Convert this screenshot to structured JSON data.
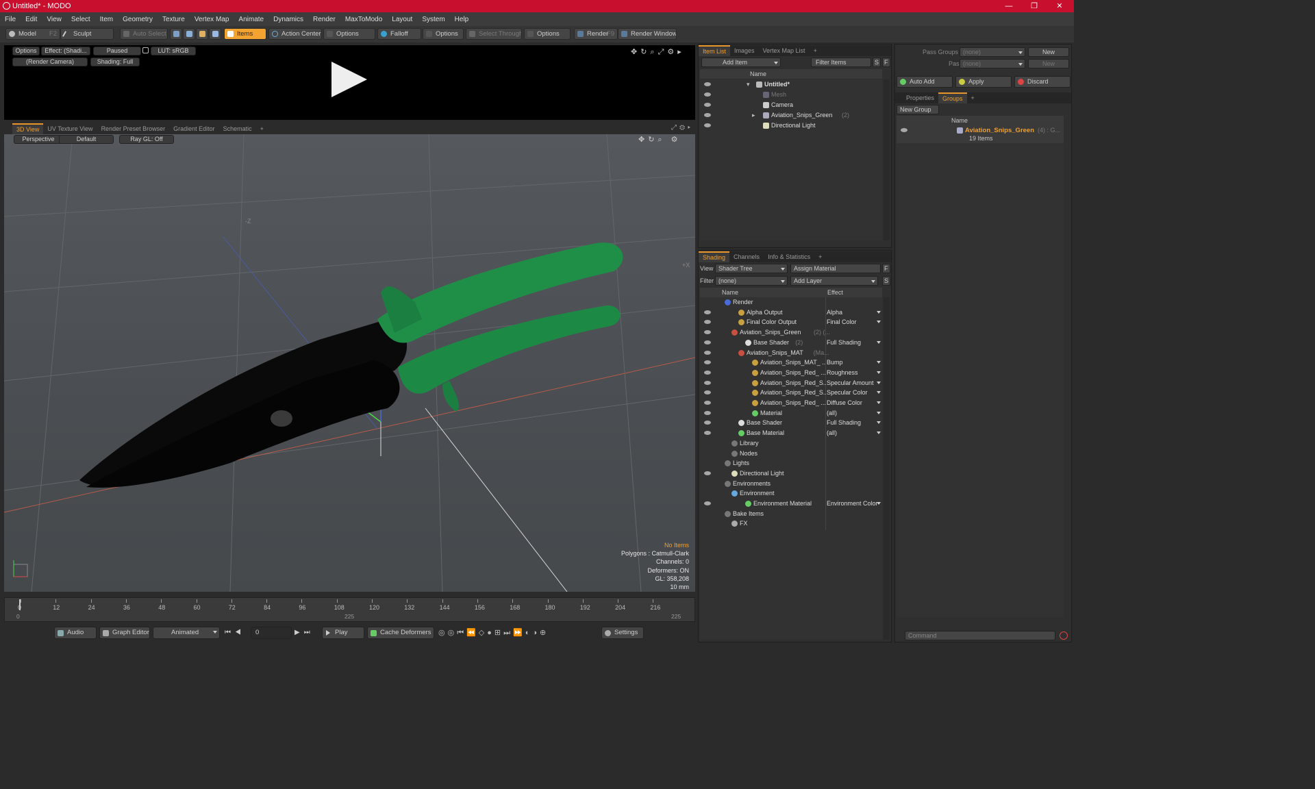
{
  "window": {
    "title": "Untitled* - MODO",
    "min": "—",
    "max": "❐",
    "close": "✕"
  },
  "menu": [
    "File",
    "Edit",
    "View",
    "Select",
    "Item",
    "Geometry",
    "Texture",
    "Vertex Map",
    "Animate",
    "Dynamics",
    "Render",
    "MaxToModo",
    "Layout",
    "System",
    "Help"
  ],
  "toolbar": {
    "model": "Model",
    "model_key": "F2",
    "sculpt": "Sculpt",
    "auto_select": "Auto Select",
    "items": "Items",
    "action_center": "Action Center",
    "options1": "Options",
    "falloff": "Falloff",
    "options2": "Options",
    "select_through": "Select Through",
    "options3": "Options",
    "render": "Render",
    "render_key": "F9",
    "render_window": "Render Window"
  },
  "preview": {
    "options": "Options",
    "effect": "Effect: (Shadi...",
    "paused": "Paused",
    "lut": "LUT: sRGB",
    "camera": "(Render Camera)",
    "shading": "Shading: Full"
  },
  "viewport_tabs": [
    "3D View",
    "UV Texture View",
    "Render Preset Browser",
    "Gradient Editor",
    "Schematic",
    "+"
  ],
  "viewport": {
    "perspective": "Perspective",
    "default": "Default",
    "raygl": "Ray GL: Off",
    "axis_label": "-Z",
    "axis_label2": "+X",
    "stats": {
      "no_items": "No Items",
      "polygons": "Polygons : Catmull-Clark",
      "channels": "Channels: 0",
      "deformers": "Deformers: ON",
      "gl": "GL: 358,208",
      "size": "10 mm"
    }
  },
  "timeline": {
    "ticks": [
      "0",
      "12",
      "24",
      "36",
      "48",
      "60",
      "72",
      "84",
      "96",
      "108",
      "120",
      "132",
      "144",
      "156",
      "168",
      "180",
      "192",
      "204",
      "216"
    ],
    "start": "0",
    "mid": "225",
    "end": "225"
  },
  "bottom": {
    "audio": "Audio",
    "graph_editor": "Graph Editor",
    "animated": "Animated",
    "frame": "0",
    "play": "Play",
    "cache": "Cache Deformers",
    "settings": "Settings"
  },
  "itemlist": {
    "tabs": [
      "Item List",
      "Images",
      "Vertex Map List",
      "+"
    ],
    "add_item": "Add Item",
    "filter": "Filter Items",
    "s": "S",
    "f": "F",
    "col_name": "Name",
    "rows": [
      {
        "label": "Untitled*",
        "bold": true
      },
      {
        "label": "Mesh",
        "dim": true
      },
      {
        "label": "Camera"
      },
      {
        "label": "Aviation_Snips_Green",
        "extra": "(2)"
      },
      {
        "label": "Directional Light"
      }
    ]
  },
  "shading": {
    "tabs": [
      "Shading",
      "Channels",
      "Info & Statistics",
      "+"
    ],
    "view_lbl": "View",
    "view_val": "Shader Tree",
    "assign": "Assign Material",
    "filter_lbl": "Filter",
    "filter_val": "(none)",
    "add_layer": "Add Layer",
    "col_name": "Name",
    "col_effect": "Effect",
    "rows": [
      {
        "label": "Render",
        "effect": ""
      },
      {
        "label": "Alpha Output",
        "effect": "Alpha"
      },
      {
        "label": "Final Color Output",
        "effect": "Final Color"
      },
      {
        "label": "Aviation_Snips_Green",
        "extra": "(2) (...",
        "effect": ""
      },
      {
        "label": "Base Shader",
        "extra": "(2)",
        "effect": "Full Shading"
      },
      {
        "label": "Aviation_Snips_MAT",
        "extra": "(Ma...",
        "effect": ""
      },
      {
        "label": "Aviation_Snips_MAT_ ...",
        "effect": "Bump"
      },
      {
        "label": "Aviation_Snips_Red_ ...",
        "effect": "Roughness"
      },
      {
        "label": "Aviation_Snips_Red_S...",
        "effect": "Specular Amount"
      },
      {
        "label": "Aviation_Snips_Red_S...",
        "effect": "Specular Color"
      },
      {
        "label": "Aviation_Snips_Red_ ...",
        "effect": "Diffuse Color"
      },
      {
        "label": "Material",
        "effect": "(all)"
      },
      {
        "label": "Base Shader",
        "effect": "Full Shading"
      },
      {
        "label": "Base Material",
        "effect": "(all)"
      },
      {
        "label": "Library",
        "effect": ""
      },
      {
        "label": "Nodes",
        "effect": ""
      },
      {
        "label": "Lights",
        "effect": ""
      },
      {
        "label": "Directional Light",
        "effect": ""
      },
      {
        "label": "Environments",
        "effect": ""
      },
      {
        "label": "Environment",
        "effect": ""
      },
      {
        "label": "Environment Material",
        "effect": "Environment Color"
      },
      {
        "label": "Bake Items",
        "effect": ""
      },
      {
        "label": "FX",
        "effect": ""
      }
    ]
  },
  "groups": {
    "pass_groups": "Pass Groups",
    "passes": "Passes",
    "none1": "(none)",
    "none2": "(none)",
    "new1": "New",
    "new2": "New",
    "auto_add": "Auto Add",
    "apply": "Apply",
    "discard": "Discard",
    "tabs": [
      "Properties",
      "Groups",
      "+"
    ],
    "new_group": "New Group",
    "col_name": "Name",
    "group_name": "Aviation_Snips_Green",
    "group_extra": "(4) : G...",
    "group_items": "19 Items",
    "command": "Command"
  },
  "colors": {
    "accent": "#f0a030",
    "title": "#c8102e",
    "handle": "#1f8f48"
  }
}
